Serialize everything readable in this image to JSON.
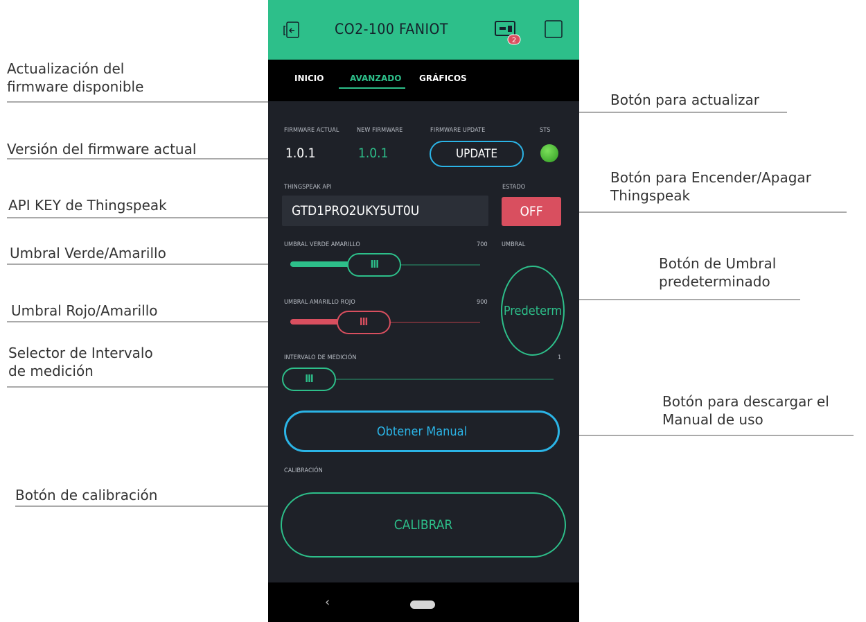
{
  "app": {
    "title": "CO2-100 FANIOT",
    "notification_count": "2",
    "icons": [
      "device-icon",
      "bluetooth-badge-icon",
      "square-icon"
    ]
  },
  "tabs": [
    {
      "label": "INICIO",
      "active": false
    },
    {
      "label": "AVANZADO",
      "active": true
    },
    {
      "label": "GRÁFICOS",
      "active": false
    }
  ],
  "firmware": {
    "actual_label": "FIRMWARE ACTUAL",
    "actual_value": "1.0.1",
    "new_label": "NEW FIRMWARE",
    "new_value": "1.0.1",
    "update_label": "FIRMWARE UPDATE",
    "update_button": "UPDATE",
    "sts_label": "STS",
    "sts_color": "#4cc239"
  },
  "thingspeak": {
    "api_label": "THINGSPEAK API",
    "api_value": "GTD1PRO2UKY5UT0U",
    "estado_label": "ESTADO",
    "estado_button": "OFF"
  },
  "umbral_verde": {
    "label": "UMBRAL VERDE AMARILLO",
    "value": "700",
    "fraction": 0.42,
    "color": "#2dbf8a"
  },
  "umbral_rojo": {
    "label": "UMBRAL AMARILLO ROJO",
    "value": "900",
    "fraction": 0.34,
    "color": "#d94f5f"
  },
  "umbral": {
    "label": "UMBRAL",
    "button": "Predeterm"
  },
  "intervalo": {
    "label": "INTERVALO DE MEDICIÓN",
    "value": "1",
    "fraction": 0.0
  },
  "manual": {
    "button": "Obtener Manual"
  },
  "calibracion": {
    "label": "CALIBRACIÓN",
    "button": "CALIBRAR"
  },
  "thumb_glyph": "lll",
  "annotations": {
    "firmware_disponible": [
      "Actualización del",
      "firmware disponible"
    ],
    "firmware_actual": [
      "Versión del firmware actual"
    ],
    "api_key": [
      "API KEY de Thingspeak"
    ],
    "umbral_verde": [
      "Umbral Verde/Amarillo"
    ],
    "umbral_rojo": [
      "Umbral Rojo/Amarillo"
    ],
    "intervalo": [
      "Selector de Intervalo",
      "de medición"
    ],
    "calibracion": [
      "Botón de calibración"
    ],
    "actualizar": [
      "Botón para actualizar"
    ],
    "thingspeak_onoff": [
      "Botón para Encender/Apagar",
      "Thingspeak"
    ],
    "umbral_pred": [
      "Botón de Umbral",
      "predeterminado"
    ],
    "manual": [
      "Botón para descargar el",
      "Manual de uso"
    ]
  },
  "colors": {
    "accent_green": "#2dbf8a",
    "accent_blue": "#2bb4e6",
    "danger_red": "#d94f5f",
    "bg_dark": "#1e2128"
  }
}
